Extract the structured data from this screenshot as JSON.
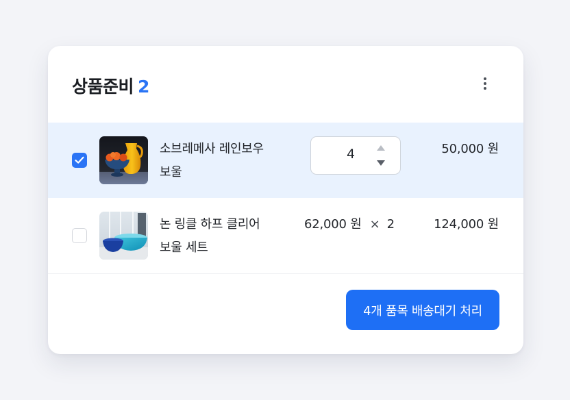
{
  "header": {
    "title": "상품준비",
    "count": "2",
    "more_icon": "more-vertical-icon"
  },
  "colors": {
    "accent": "#2a74f5",
    "selected_row": "#e9f2fe",
    "button": "#1e6ff5"
  },
  "items": [
    {
      "checked": true,
      "name_line1": "소브레메사 레인보우",
      "name_line2": "보울",
      "quantity": "4",
      "total": "50,000 원",
      "image": "yellow-pitcher-fruit-bowl"
    },
    {
      "checked": false,
      "name_line1": "논 링클 하프 클리어",
      "name_line2": "보울 세트",
      "unit_price": "62,000 원",
      "times": "×",
      "quantity": "2",
      "total": "124,000 원",
      "image": "blue-bowls-set"
    }
  ],
  "action": {
    "label": "4개 품목 배송대기 처리"
  }
}
